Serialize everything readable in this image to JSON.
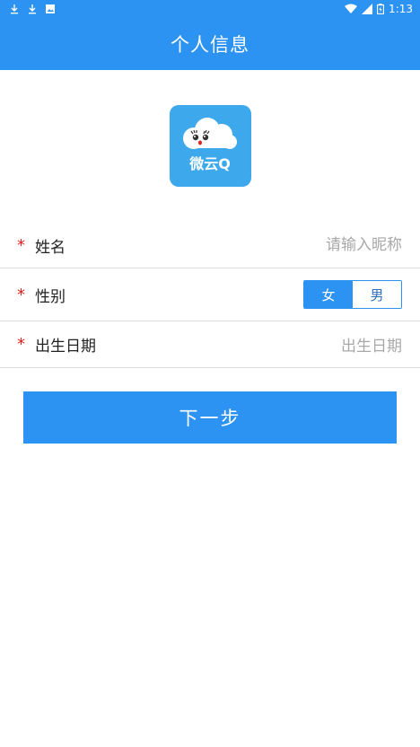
{
  "status_bar": {
    "time": "1:13",
    "left_icons": [
      "download-icon",
      "download-icon",
      "image-icon"
    ],
    "right_icons": [
      "wifi-icon",
      "signal-icon",
      "battery-icon"
    ]
  },
  "header": {
    "title": "个人信息"
  },
  "logo": {
    "text": "微云Q",
    "icon": "cloud-face-icon"
  },
  "form": {
    "required_mark": "*",
    "name": {
      "label": "姓名",
      "placeholder": "请输入昵称",
      "value": ""
    },
    "gender": {
      "label": "性别",
      "options": [
        "女",
        "男"
      ],
      "selected": "女"
    },
    "birthday": {
      "label": "出生日期",
      "placeholder": "出生日期"
    }
  },
  "actions": {
    "next_label": "下一步"
  },
  "colors": {
    "primary": "#2d93f2",
    "required": "#e3201b",
    "placeholder": "#a8a8a8"
  }
}
